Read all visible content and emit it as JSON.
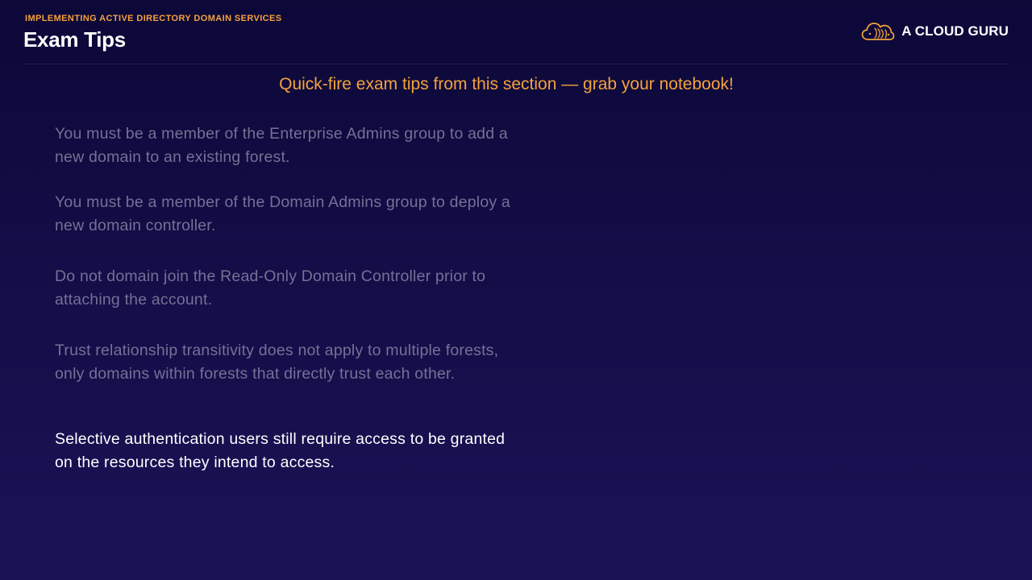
{
  "header": {
    "kicker": "IMPLEMENTING ACTIVE DIRECTORY DOMAIN SERVICES",
    "title": "Exam Tips"
  },
  "brand": {
    "name": "A CLOUD GURU",
    "icon": "cloud-logo-icon",
    "accent_color": "#f5a23c"
  },
  "subtitle": "Quick-fire exam tips from this section — grab your notebook!",
  "tips": [
    {
      "text": "You must be a member of the Enterprise Admins group to add a new domain to an existing forest."
    },
    {
      "text": "You must be a member of the Domain Admins group to deploy a new domain controller."
    },
    {
      "text": "Do not domain join the Read-Only Domain Controller prior to attaching the account."
    },
    {
      "text": "Trust relationship transitivity does not apply to multiple forests, only domains within forests that directly trust each other."
    },
    {
      "text": "Selective authentication users still require access to be granted on the resources they intend to access."
    }
  ],
  "colors": {
    "background_top": "#0c0838",
    "background_bottom": "#1b1255",
    "dim_text": "#747195",
    "active_text": "#ffffff"
  }
}
